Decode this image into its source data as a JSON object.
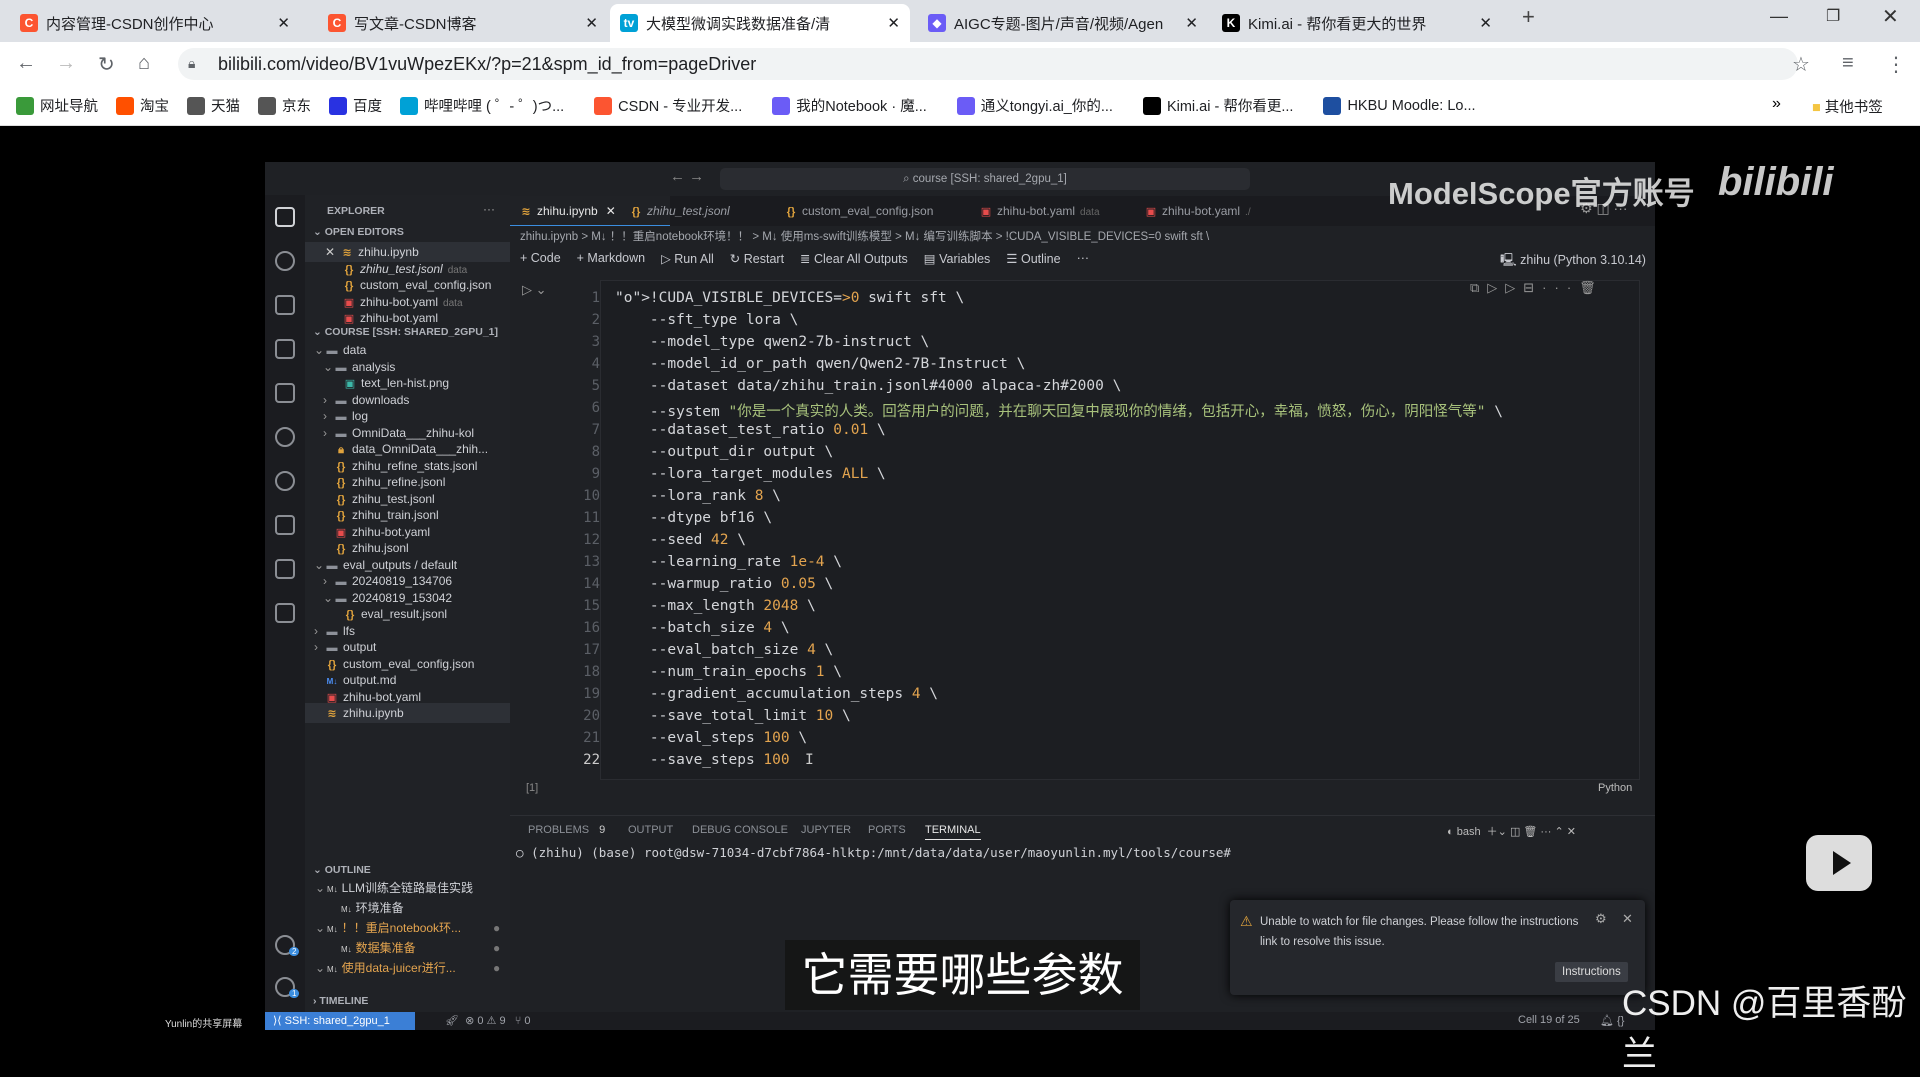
{
  "browser": {
    "tabs": [
      {
        "title": "内容管理-CSDN创作中心",
        "favicon": "C",
        "color": "#fc5531"
      },
      {
        "title": "写文章-CSDN博客",
        "favicon": "C",
        "color": "#fc5531"
      },
      {
        "title": "大模型微调实践数据准备/清",
        "favicon": "tv",
        "color": "#00a1d6",
        "active": true
      },
      {
        "title": "AIGC专题-图片/声音/视频/Agen",
        "favicon": "◆",
        "color": "#6b5cf6"
      },
      {
        "title": "Kimi.ai - 帮你看更大的世界",
        "favicon": "K",
        "color": "#000000"
      }
    ],
    "new_tab": "+",
    "url": "bilibili.com/video/BV1vuWpezEKx/?p=21&spm_id_from=pageDriver",
    "bookmarks": [
      "网址导航",
      "淘宝",
      "天猫",
      "京东",
      "百度",
      "哔哩哔哩 ( ゜- ゜)つ...",
      "CSDN - 专业开发...",
      "我的Notebook · 魔...",
      "通义tongyi.ai_你的...",
      "Kimi.ai - 帮你看更...",
      "HKBU Moodle: Lo..."
    ],
    "bookmarks_more": "»",
    "other_bookmarks": "其他书签"
  },
  "video": {
    "watermark": "ModelScope官方账号",
    "logo": "bilibili",
    "subtitle": "它需要哪些参数",
    "csdn_watermark": "CSDN @百里香酚兰",
    "share_label": "Yunlin的共享屏幕"
  },
  "vscode": {
    "search": "course [SSH: shared_2gpu_1]",
    "explorer_title": "EXPLORER",
    "open_editors_title": "OPEN EDITORS",
    "open_editors": [
      {
        "name": "zhihu.ipynb",
        "icon": "notebook",
        "hint": ""
      },
      {
        "name": "zhihu_test.jsonl",
        "icon": "json",
        "hint": "data"
      },
      {
        "name": "custom_eval_config.json",
        "icon": "json",
        "hint": ""
      },
      {
        "name": "zhihu-bot.yaml",
        "icon": "yaml",
        "hint": "data"
      },
      {
        "name": "zhihu-bot.yaml",
        "icon": "yaml",
        "hint": ""
      }
    ],
    "workspace_title": "COURSE [SSH: SHARED_2GPU_1]",
    "tree": [
      {
        "name": "data",
        "icon": "folder",
        "depth": 1,
        "arrow": "v"
      },
      {
        "name": "analysis",
        "icon": "folder",
        "depth": 2,
        "arrow": "v"
      },
      {
        "name": "text_len-hist.png",
        "icon": "image",
        "depth": 3,
        "arrow": ""
      },
      {
        "name": "downloads",
        "icon": "folder",
        "depth": 2,
        "arrow": ">"
      },
      {
        "name": "log",
        "icon": "folder",
        "depth": 2,
        "arrow": ">"
      },
      {
        "name": "OmniData___zhihu-kol",
        "icon": "folder",
        "depth": 2,
        "arrow": ">"
      },
      {
        "name": "data_OmniData___zhih...",
        "icon": "lock",
        "depth": 2,
        "arrow": ""
      },
      {
        "name": "zhihu_refine_stats.jsonl",
        "icon": "json",
        "depth": 2,
        "arrow": ""
      },
      {
        "name": "zhihu_refine.jsonl",
        "icon": "json",
        "depth": 2,
        "arrow": ""
      },
      {
        "name": "zhihu_test.jsonl",
        "icon": "json",
        "depth": 2,
        "arrow": ""
      },
      {
        "name": "zhihu_train.jsonl",
        "icon": "json",
        "depth": 2,
        "arrow": ""
      },
      {
        "name": "zhihu-bot.yaml",
        "icon": "yaml",
        "depth": 2,
        "arrow": ""
      },
      {
        "name": "zhihu.jsonl",
        "icon": "json",
        "depth": 2,
        "arrow": ""
      },
      {
        "name": "eval_outputs / default",
        "icon": "folder",
        "depth": 1,
        "arrow": "v"
      },
      {
        "name": "20240819_134706",
        "icon": "folder",
        "depth": 2,
        "arrow": ">"
      },
      {
        "name": "20240819_153042",
        "icon": "folder",
        "depth": 2,
        "arrow": "v"
      },
      {
        "name": "eval_result.jsonl",
        "icon": "json",
        "depth": 3,
        "arrow": ""
      },
      {
        "name": "lfs",
        "icon": "folder",
        "depth": 1,
        "arrow": ">"
      },
      {
        "name": "output",
        "icon": "folder",
        "depth": 1,
        "arrow": ">"
      },
      {
        "name": "custom_eval_config.json",
        "icon": "json",
        "depth": 1,
        "arrow": ""
      },
      {
        "name": "output.md",
        "icon": "markdown",
        "depth": 1,
        "arrow": ""
      },
      {
        "name": "zhihu-bot.yaml",
        "icon": "yaml",
        "depth": 1,
        "arrow": ""
      },
      {
        "name": "zhihu.ipynb",
        "icon": "notebook",
        "depth": 1,
        "arrow": "",
        "selected": true
      }
    ],
    "outline_title": "OUTLINE",
    "outline": [
      {
        "text": "LLM训练全链路最佳实践",
        "depth": 0,
        "arrow": "v"
      },
      {
        "text": "环境准备",
        "depth": 1,
        "arrow": ""
      },
      {
        "text": "！！重启notebook环...",
        "depth": 0,
        "arrow": "v",
        "modified": true
      },
      {
        "text": "数据集准备",
        "depth": 1,
        "arrow": "",
        "modified": true
      },
      {
        "text": "使用data-juicer进行...",
        "depth": 0,
        "arrow": "v",
        "modified": true
      }
    ],
    "timeline_title": "TIMELINE",
    "accounts_badge": "2",
    "settings_badge": "1",
    "editor_tabs": [
      {
        "name": "zhihu.ipynb",
        "icon": "notebook",
        "active": true
      },
      {
        "name": "zhihu_test.jsonl",
        "icon": "json",
        "hint": ""
      },
      {
        "name": "custom_eval_config.json",
        "icon": "json",
        "hint": ""
      },
      {
        "name": "zhihu-bot.yaml",
        "icon": "yaml",
        "hint": "data"
      },
      {
        "name": "zhihu-bot.yaml",
        "icon": "yaml",
        "hint": "./"
      }
    ],
    "breadcrumb": "zhihu.ipynb > M↓ ！！重启notebook环境！！ > M↓ 使用ms-swift训练模型 > M↓ 编写训练脚本 > !CUDA_VISIBLE_DEVICES=0 swift sft \\",
    "toolbar": {
      "code": "+ Code",
      "markdown": "+ Markdown",
      "run_all": "Run All",
      "restart": "Restart",
      "clear": "Clear All Outputs",
      "variables": "Variables",
      "outline": "Outline",
      "more": "···"
    },
    "kernel": "zhihu (Python 3.10.14)",
    "cell_exec": "[1]",
    "cell_lang": "Python",
    "code_lines": [
      "!CUDA_VISIBLE_DEVICES=0 swift sft \\",
      "    --sft_type lora \\",
      "    --model_type qwen2-7b-instruct \\",
      "    --model_id_or_path qwen/Qwen2-7B-Instruct \\",
      "    --dataset data/zhihu_train.jsonl#4000 alpaca-zh#2000 \\",
      "    --system \"你是一个真实的人类。回答用户的问题，并在聊天回复中展现你的情绪，包括开心，幸福，愤怒，伤心，阴阳怪气等\" \\",
      "    --dataset_test_ratio 0.01 \\",
      "    --output_dir output \\",
      "    --lora_target_modules ALL \\",
      "    --lora_rank 8 \\",
      "    --dtype bf16 \\",
      "    --seed 42 \\",
      "    --learning_rate 1e-4 \\",
      "    --warmup_ratio 0.05 \\",
      "    --max_length 2048 \\",
      "    --batch_size 4 \\",
      "    --eval_batch_size 4 \\",
      "    --num_train_epochs 1 \\",
      "    --gradient_accumulation_steps 4 \\",
      "    --save_total_limit 10 \\",
      "    --eval_steps 100 \\",
      "    --save_steps 100"
    ],
    "panel_tabs": [
      "PROBLEMS",
      "OUTPUT",
      "DEBUG CONSOLE",
      "JUPYTER",
      "PORTS",
      "TERMINAL"
    ],
    "problems_count": "9",
    "active_panel": "TERMINAL",
    "terminal_shell": "bash",
    "terminal_line": "(zhihu) (base) root@dsw-71034-d7cbf7864-hlktp:/mnt/data/data/user/maoyunlin.myl/tools/course#",
    "notification": {
      "text": "Unable to watch for file changes. Please follow the instructions link to resolve this issue.",
      "button": "Instructions"
    },
    "status": {
      "remote": "SSH: shared_2gpu_1",
      "errors": "0",
      "warnings": "9",
      "ports": "0",
      "cell": "Cell 19 of 25"
    }
  }
}
